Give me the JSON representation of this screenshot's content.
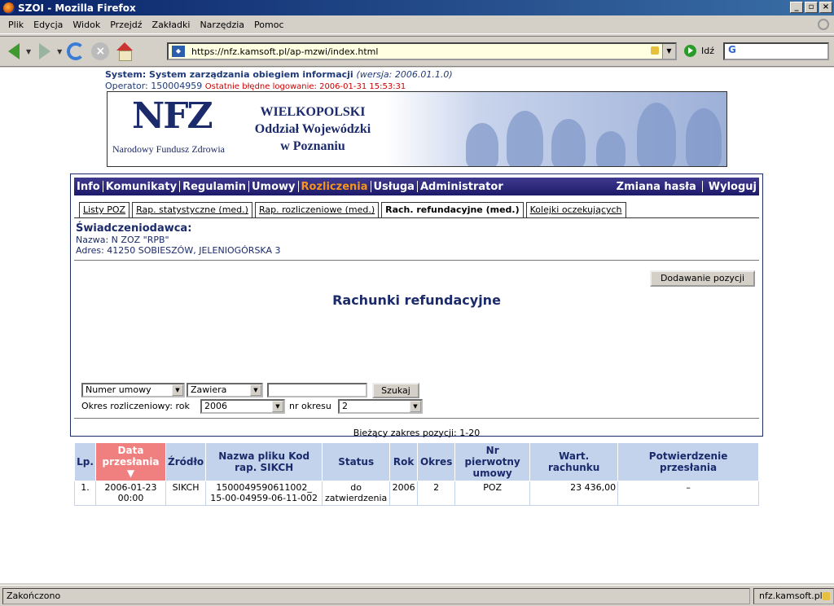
{
  "window": {
    "title": "SZOI - Mozilla Firefox"
  },
  "menubar": [
    "Plik",
    "Edycja",
    "Widok",
    "Przejdź",
    "Zakładki",
    "Narzędzia",
    "Pomoc"
  ],
  "toolbar": {
    "url": "https://nfz.kamsoft.pl/ap-mzwi/index.html",
    "go_label": "Idź"
  },
  "header": {
    "system_label": "System: System zarządzania obiegiem informacji",
    "version": "(wersja: 2006.01.1.0)",
    "operator": "Operator: 150004959",
    "last_failed_login": "Ostatnie błędne logowanie: 2006-01-31 15:53:31"
  },
  "banner": {
    "logo": "NFZ",
    "logo_sub": "Narodowy Fundusz Zdrowia",
    "region_line1": "WIELKOPOLSKI",
    "region_line2": "Oddział Wojewódzki",
    "region_line3": "w Poznaniu"
  },
  "mainnav": {
    "items": [
      "Info",
      "Komunikaty",
      "Regulamin",
      "Umowy",
      "Rozliczenia",
      "Usługa",
      "Administrator"
    ],
    "active": "Rozliczenia",
    "right": [
      "Zmiana hasła",
      "Wyloguj"
    ]
  },
  "subtabs": [
    "Listy POZ",
    "Rap. statystyczne (med.)",
    "Rap. rozliczeniowe (med.)",
    "Rach. refundacyjne (med.)",
    "Kolejki oczekujących"
  ],
  "provider": {
    "heading": "Świadczeniodawca:",
    "name": "Nazwa: N ZOZ \"RPB\"",
    "address": "Adres: 41250 SOBIESZÓW, JELENIOGÓRSKA 3"
  },
  "page": {
    "add_button": "Dodawanie pozycji",
    "title": "Rachunki refundacyjne"
  },
  "filters": {
    "field": "Numer umowy",
    "operator": "Zawiera",
    "search_button": "Szukaj",
    "period_label": "Okres rozliczeniowy: rok",
    "year": "2006",
    "period_no_label": "nr okresu",
    "period_no": "2"
  },
  "range_text": "Bieżący zakres pozycji: 1-20",
  "table": {
    "headers": [
      "Lp.",
      "Data przesłania",
      "Źródło",
      "Nazwa pliku Kod rap. SIKCH",
      "Status",
      "Rok",
      "Okres",
      "Nr pierwotny umowy",
      "Wart. rachunku",
      "Potwierdzenie przesłania"
    ],
    "rows": [
      {
        "lp": "1.",
        "date": "2006-01-23",
        "time": "00:00",
        "source": "SIKCH",
        "file": "1500049590611002_",
        "code": "15-00-04959-06-11-002",
        "status1": "do",
        "status2": "zatwierdzenia",
        "year": "2006",
        "period": "2",
        "contract": "POZ",
        "value": "23 436,00",
        "confirm": "–"
      }
    ]
  },
  "statusbar": {
    "left": "Zakończono",
    "right": "nfz.kamsoft.pl"
  }
}
